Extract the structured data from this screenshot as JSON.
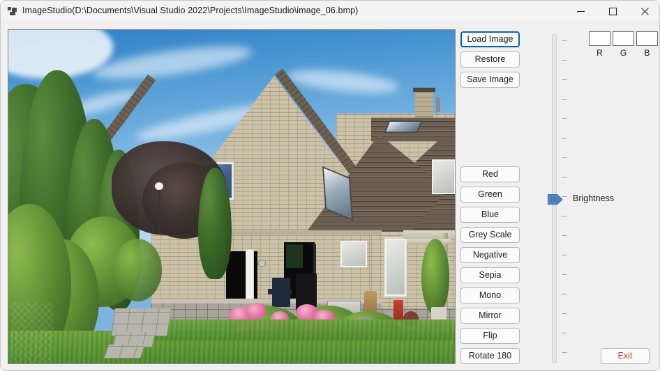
{
  "window": {
    "title": "ImageStudio(D:\\Documents\\Visual Studio 2022\\Projects\\ImageStudio\\image_06.bmp)",
    "icon": "windows-forms-app-icon",
    "controls": {
      "minimize": "minimize-icon",
      "maximize": "maximize-icon",
      "close": "close-icon"
    }
  },
  "file_buttons": [
    {
      "label": "Load Image",
      "focused": true
    },
    {
      "label": "Restore",
      "focused": false
    },
    {
      "label": "Save Image",
      "focused": false
    }
  ],
  "filter_buttons": [
    {
      "label": "Red"
    },
    {
      "label": "Green"
    },
    {
      "label": "Blue"
    },
    {
      "label": "Grey Scale"
    },
    {
      "label": "Negative"
    },
    {
      "label": "Sepia"
    },
    {
      "label": "Mono"
    },
    {
      "label": "Mirror"
    },
    {
      "label": "Flip"
    },
    {
      "label": "Rotate 180"
    }
  ],
  "rgb_readout": {
    "fields": [
      {
        "label": "R",
        "value": ""
      },
      {
        "label": "G",
        "value": ""
      },
      {
        "label": "B",
        "value": ""
      }
    ]
  },
  "brightness": {
    "label": "Brightness",
    "orientation": "vertical",
    "thumb_position_percent": 50,
    "tick_count": 17
  },
  "exit_button": {
    "label": "Exit",
    "color": "#c23a2b"
  },
  "picture_box": {
    "alt": "Photograph of a brick house with a steep gabled tiled roof, chimney and skylight, surrounded by conifers and a dark-leaved tree under a blue sky, with a paved patio, pink hydrangea bushes and a green lawn in the foreground."
  },
  "colors": {
    "window_background": "#f0f0f0",
    "titlebar": "#f3f3f3",
    "button_face": "#fbfbfb",
    "focus_border": "#0a64ad",
    "thumb": "#4a7ebb",
    "exit_text": "#c23a2b"
  }
}
